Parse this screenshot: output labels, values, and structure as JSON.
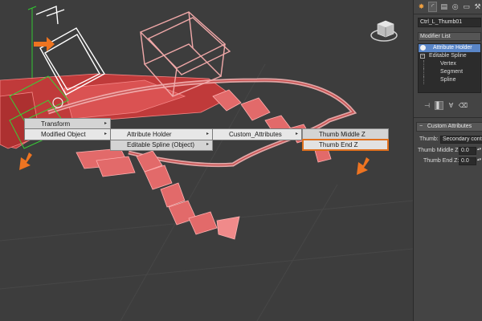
{
  "quad_menu": {
    "menu1": [
      {
        "label": "Transform",
        "has_submenu": true
      },
      {
        "label": "Modified Object",
        "has_submenu": true,
        "highlighted": true
      }
    ],
    "menu2": [
      {
        "label": "Attribute Holder",
        "has_submenu": true,
        "highlighted": true
      },
      {
        "label": "Editable Spline (Object)",
        "has_submenu": true
      }
    ],
    "menu3": [
      {
        "label": "Custom_Attributes",
        "has_submenu": true,
        "highlighted": true
      }
    ],
    "menu4": [
      {
        "label": "Thumb Middle Z"
      },
      {
        "label": "Thumb End Z",
        "boxed": true
      }
    ],
    "submenu_arrow": "▸"
  },
  "command_panel": {
    "tabs": [
      {
        "icon": "sun-icon",
        "glyph": "✸"
      },
      {
        "icon": "modify-arc-icon",
        "glyph": "◜"
      },
      {
        "icon": "hierarchy-icon",
        "glyph": "▤"
      },
      {
        "icon": "motion-icon",
        "glyph": "◎"
      },
      {
        "icon": "display-icon",
        "glyph": "▭"
      },
      {
        "icon": "utilities-icon",
        "glyph": "⚒"
      }
    ],
    "object_name": "Ctrl_L_Thumb01",
    "modifier_list_label": "Modifier List",
    "stack": [
      {
        "label": "Attribute Holder",
        "selected": true,
        "icon": "lightbulb-icon"
      },
      {
        "label": "Editable Spline",
        "expand": "−"
      },
      {
        "label": "Vertex",
        "sub": true
      },
      {
        "label": "Segment",
        "sub": true
      },
      {
        "label": "Spline",
        "sub": true
      }
    ],
    "toolbar": [
      {
        "icon": "pin-stack-icon",
        "glyph": "⊣"
      },
      {
        "icon": "show-end-result-icon",
        "glyph": "▌"
      },
      {
        "icon": "make-unique-icon",
        "glyph": "∀"
      },
      {
        "icon": "remove-modifier-icon",
        "glyph": "⌫"
      }
    ],
    "custom_attributes": {
      "rollout_title": "Custom Attributes",
      "rollout_toggle": "−",
      "thumb_label": "Thumb:",
      "thumb_value": "Secondary contr",
      "middle_label": "Thumb Middle Z:",
      "middle_value": "0.0",
      "end_label": "Thumb End Z:",
      "end_value": "0.0"
    }
  },
  "colors": {
    "accent_orange": "#e0701e",
    "selection_blue": "#5a86c8",
    "mesh_red": "#d84a4a",
    "mesh_pink": "#f0a0a0",
    "viewport_bg": "#3d3d3d"
  }
}
